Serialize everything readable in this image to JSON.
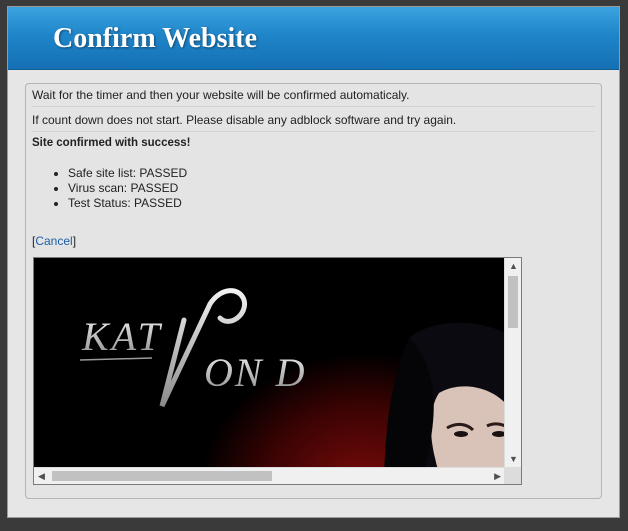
{
  "header": {
    "title": "Confirm Website"
  },
  "content": {
    "line1": "Wait for the timer and then your website will be confirmed automaticaly.",
    "line2": "If count down does not start. Please disable any adblock software and try again.",
    "success": "Site confirmed with success!",
    "checks": [
      "Safe site list: PASSED",
      "Virus scan: PASSED",
      "Test Status: PASSED"
    ],
    "cancel": {
      "open": "[",
      "label": "Cancel",
      "close": "]"
    }
  },
  "ad": {
    "logo_left": "KAT",
    "logo_right": "ON D",
    "colors": {
      "background": "#000000",
      "glow": "#7a0a0a",
      "logo": "#d8d8d8"
    }
  },
  "theme": {
    "header_blue": "#1f85c9",
    "link": "#1a5fa8"
  }
}
